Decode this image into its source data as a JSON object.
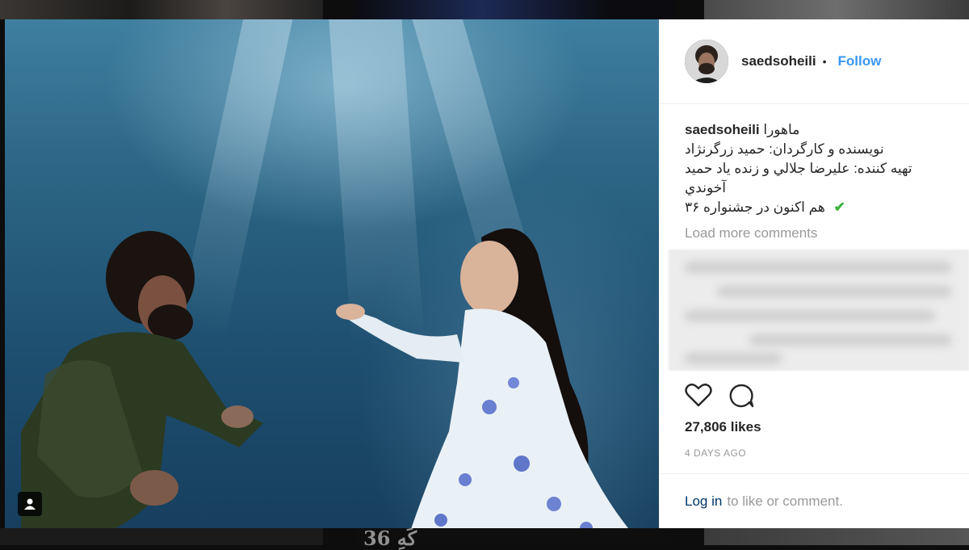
{
  "post": {
    "username": "saedsoheili",
    "separator": "•",
    "follow_label": "Follow",
    "caption_username": "saedsoheili",
    "caption_line1": "ماهورا",
    "caption_line2": "نویسنده و کارگردان: حمید زرگرنژاد",
    "caption_line3": "تهیه کننده: علیرضا جلالي و زنده یاد حمید",
    "caption_line4": "آخوندي",
    "caption_line5": "هم اکنون در جشنواره ۳۶",
    "check_icon": "✔",
    "load_more": "Load more comments",
    "likes": "27,806 likes",
    "time": "4 DAYS AGO",
    "login_link": "Log in",
    "login_rest": "to like or comment."
  },
  "background": {
    "bottom_text": "كَهِ 36"
  },
  "icons": {
    "heart": "heart-icon",
    "comment": "comment-icon",
    "profile": "user-tag-icon",
    "verified": "check-icon"
  },
  "colors": {
    "follow": "#3897f0",
    "login": "#003569",
    "check": "#3fb23f"
  }
}
